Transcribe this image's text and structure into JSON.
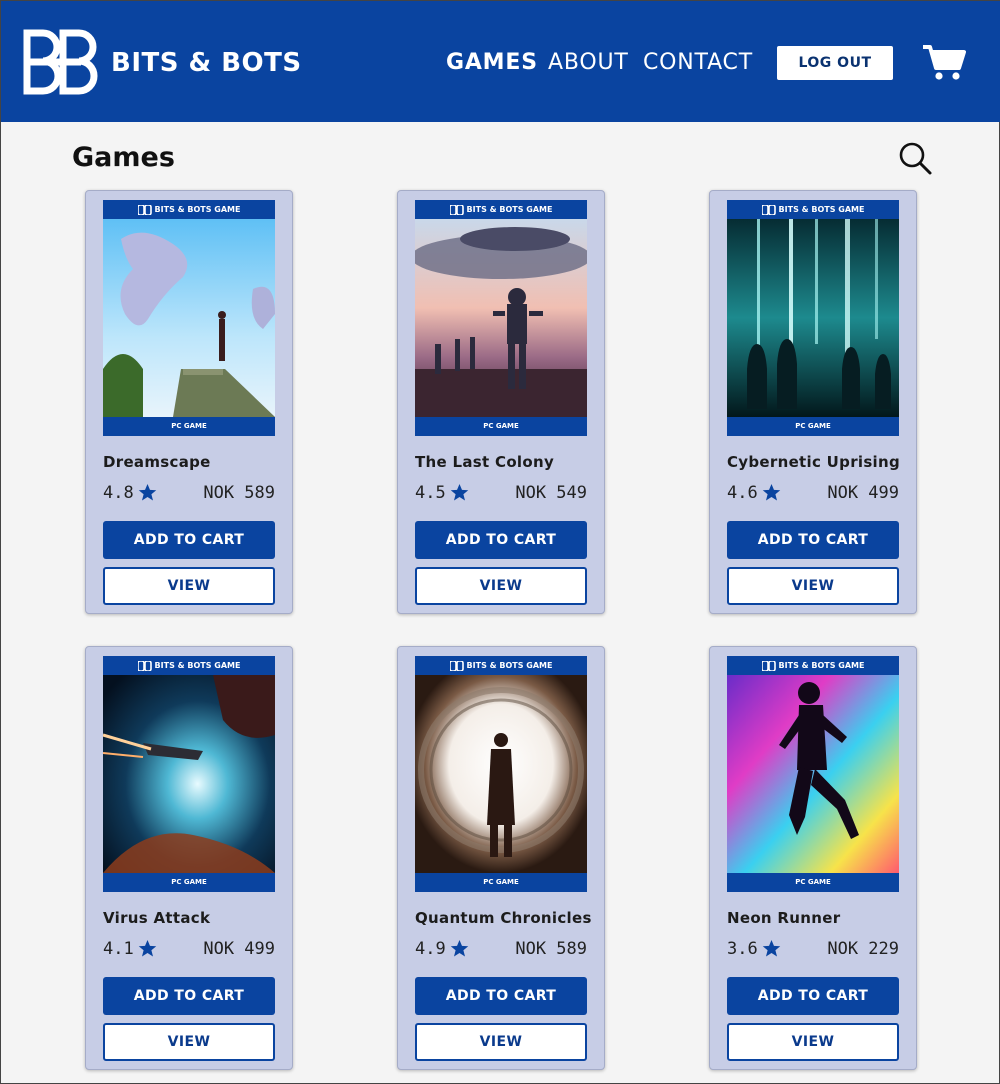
{
  "brand": {
    "name": "BITS & BOTS",
    "logo_icon": "bb-logo-icon"
  },
  "nav": {
    "games": "GAMES",
    "about": "ABOUT",
    "contact": "CONTACT"
  },
  "header": {
    "logout_label": "LOG OUT",
    "cart_icon": "cart-icon"
  },
  "page": {
    "title": "Games",
    "search_icon": "search-icon"
  },
  "colors": {
    "primary": "#0a44a0",
    "card_bg": "#c7cde6",
    "page_bg": "#f4f4f4"
  },
  "cover_labels": {
    "top": "BITS & BOTS GAME",
    "bottom": "PC GAME"
  },
  "buttons": {
    "add_to_cart": "ADD TO CART",
    "view": "VIEW"
  },
  "games": [
    {
      "title": "Dreamscape",
      "rating": "4.8",
      "price": "NOK 589"
    },
    {
      "title": "The Last Colony",
      "rating": "4.5",
      "price": "NOK 549"
    },
    {
      "title": "Cybernetic Uprising",
      "rating": "4.6",
      "price": "NOK 499"
    },
    {
      "title": "Virus Attack",
      "rating": "4.1",
      "price": "NOK 499"
    },
    {
      "title": "Quantum Chronicles",
      "rating": "4.9",
      "price": "NOK 589"
    },
    {
      "title": "Neon Runner",
      "rating": "3.6",
      "price": "NOK 229"
    }
  ]
}
